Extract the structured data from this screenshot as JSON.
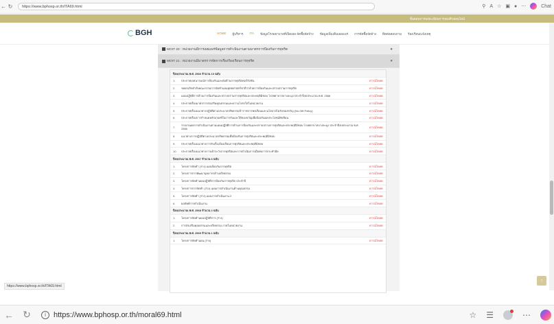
{
  "browser_top": {
    "url": "https://www.bphosp.or.th/ITA69.html",
    "icons": [
      "back-icon",
      "refresh-icon",
      "zoom-icon",
      "read-aloud-icon",
      "favorite-icon",
      "extensions-icon",
      "profile-icon",
      "more-icon",
      "copilot-icon"
    ],
    "chat_label": "Chat"
  },
  "gold_bar": {
    "text": "ขั้นตอนการลงทะเบียนการจองคิวออนไลน์"
  },
  "header": {
    "logo_text": "BGH",
    "menu": [
      "HOME",
      "ผู้บริหาร",
      "ITA",
      "ข้อมูลโรงพยาบาลที่เปิดเผย-จัดซื้อจัดจ้าง",
      "ข้อมูลเพิ่มเติมเผยแพร่",
      "การจัดซื้อจัดจ้าง",
      "ติดต่อสอบถาม",
      "ร้องเรียน/แจ้งเหตุ"
    ]
  },
  "sections": {
    "s1": "MOIT 20 : หน่วยงานมีการเผยแพร่ข้อมูลการดำเนินงานตามมาตรการป้องกันการทุจริต",
    "s2": "MOIT 21 : หน่วยงานมีมาตรการจัดการเรื่องร้องเรียนการทุจริต"
  },
  "download_label": "ดาวน์โหลด",
  "years": [
    {
      "label": "ปีงบประมาณ พ.ศ. 2566 จำนวน 10 ฉบับ",
      "items": [
        {
          "num": "1.",
          "title": "ประกาศเจตนารมณ์การป้องกันและต่อต้านการทุจริตคอร์รัปชัน"
        },
        {
          "num": "2.",
          "title": "ขอยกเลิกคำสั่งคณะกรรมการจัดทำแผนยุทธศาสตร์ชาติว่าด้วยการป้องกันและปราบปรามการทุจริต"
        },
        {
          "num": "3.",
          "title": "แผนปฏิบัติการด้านการป้องกันและปราบปรามการทุจริตและประพฤติมิชอบ โรงพยาบาลบางละมุง ประจำปีงบประมาณ พ.ศ. 2566"
        },
        {
          "num": "4.",
          "title": "ประกาศเรื่องมาตรการส่งเสริมคุณธรรมและความโปร่งใสในหน่วยงาน"
        },
        {
          "num": "5.",
          "title": "ประกาศเรื่องแนวทางปฏิบัติตามประมวลจริยธรรมข้าราชการพลเรือนและนโยบายไม่รับของขวัญ (No Gift Policy)"
        },
        {
          "num": "6.",
          "title": "ประกาศเรื่องการกำหนดหลักเกณฑ์ในการรับและให้ของขวัญเพื่อป้องกันผลประโยชน์ทับซ้อน"
        },
        {
          "num": "7.",
          "title": "รายงานผลการดำเนินงานตามแผนปฏิบัติการด้านการป้องกันและปราบปรามการทุจริตและประพฤติมิชอบ โรงพยาบาลบางละมุง ประจำปีงบประมาณ พ.ศ. 2566"
        },
        {
          "num": "8.",
          "title": "แนวทางการปฏิบัติตามประมวลจริยธรรมเพื่อป้องกันการทุจริตและประพฤติมิชอบ"
        },
        {
          "num": "9.",
          "title": "ประกาศเรื่องแนวทางการรับเรื่องร้องเรียนการทุจริตและประพฤติมิชอบ"
        },
        {
          "num": "10.",
          "title": "ประกาศเรื่องแนวทางการเฝ้าระวังการทุจริตและการดำเนินการเมื่อพบการกระทำผิด"
        }
      ]
    },
    {
      "label": "ปีงบประมาณ พ.ศ. 2567 จำนวน 6 ฉบับ",
      "items": [
        {
          "num": "1.",
          "title": "โครงการจัดทำ (ร่าง) แผนป้องกันการทุจริต"
        },
        {
          "num": "2.",
          "title": "โครงการการพัฒนาบุคลากรด้านจริยธรรม"
        },
        {
          "num": "3.",
          "title": "โครงการจัดทำแผนปฏิบัติการป้องกันการทุจริต ประจำปี"
        },
        {
          "num": "4.",
          "title": "โครงการการจัดทำ (ร่าง) แผนการดำเนินงานด้านคุณธรรม"
        },
        {
          "num": "5.",
          "title": "โครงการจัดทำ (ร่าง) แผนการดำเนินงาน 2"
        },
        {
          "num": "6.",
          "title": "ผลลัพธ์การดำเนินงาน"
        }
      ]
    },
    {
      "label": "ปีงบประมาณ พ.ศ. 2568 จำนวน 2 ฉบับ",
      "items": [
        {
          "num": "1.",
          "title": "โครงการจัดทำแผนปฏิบัติการ (ร่าง)"
        },
        {
          "num": "2.",
          "title": "การส่งเสริมคุณธรรมและจริยธรรม ภายในหน่วยงาน"
        }
      ]
    },
    {
      "label": "ปีงบประมาณ พ.ศ. 2569 จำนวน 1 ฉบับ",
      "items": [
        {
          "num": "1.",
          "title": "โครงการจัดทำแผน (ร่าง)"
        }
      ]
    }
  ],
  "status_url": "https://www.bphosp.or.th/ITA69.html",
  "bottom_url": "https://www.bphosp.or.th/moral69.html",
  "colors": {
    "gold": "#c7bc7d",
    "download": "#dd3333",
    "accent": "#d88a1a"
  }
}
